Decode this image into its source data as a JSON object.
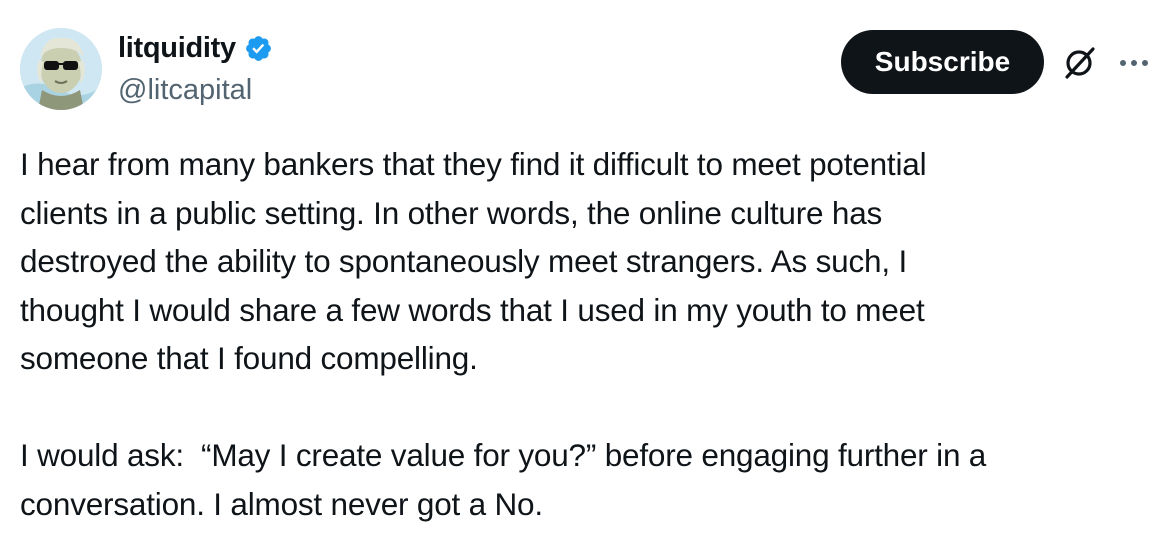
{
  "author": {
    "display_name": "litquidity",
    "handle": "@litcapital",
    "verified": true,
    "verified_color": "#1d9bf0",
    "avatar_icon": "avatar-washington-sunglasses"
  },
  "actions": {
    "subscribe_label": "Subscribe",
    "grok_icon": "grok-icon",
    "more_icon": "more-icon"
  },
  "tweet": {
    "paragraph_1": "I hear from many bankers that they find it difficult to meet potential\nclients in a public setting. In other words, the online culture has\ndestroyed the ability to spontaneously meet strangers. As such, I\nthought I would share a few words that I used in my youth to meet\nsomeone that I found compelling.",
    "paragraph_2": "I would ask:  “May I create value for you?” before engaging further in a\nconversation. I almost never got a No."
  }
}
